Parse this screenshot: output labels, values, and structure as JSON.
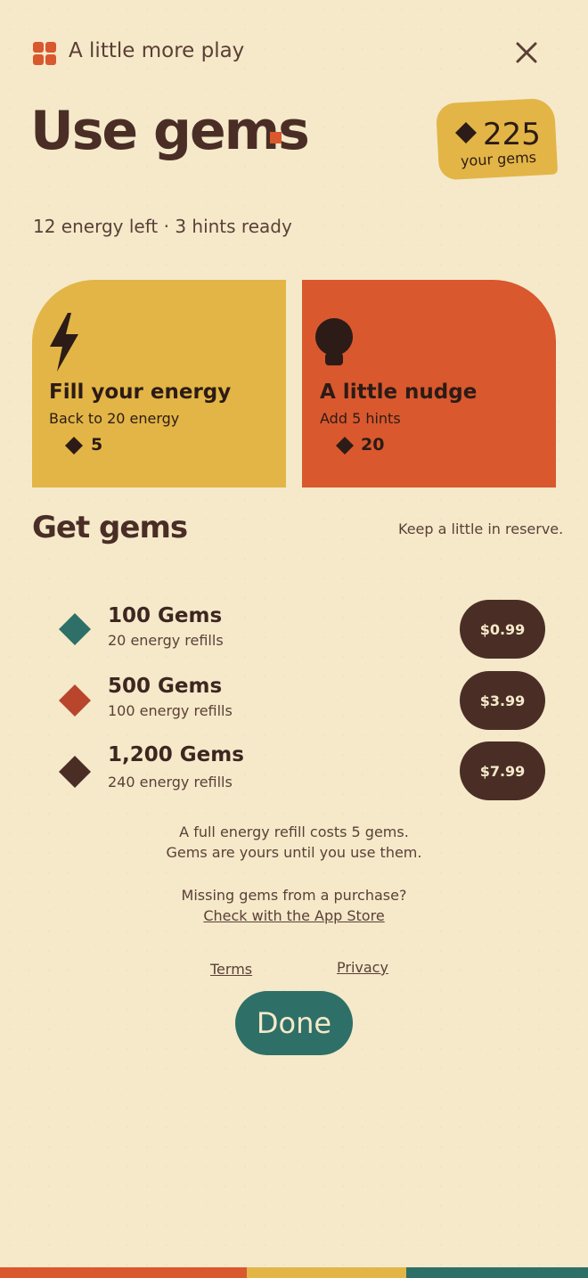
{
  "header": {
    "app_name": "A little more play",
    "close_icon": "close-icon"
  },
  "title": "Use gems",
  "balance": {
    "value": "225",
    "label": "your gems"
  },
  "status": "12 energy left · 3 hints ready",
  "cards": [
    {
      "icon": "lightning-icon",
      "title": "Fill your energy",
      "subtitle": "Back to 20 energy",
      "price": "5"
    },
    {
      "icon": "lightbulb-icon",
      "title": "A little nudge",
      "subtitle": "Add 5 hints",
      "price": "20"
    }
  ],
  "get_gems": {
    "title": "Get gems",
    "note": "Keep a little in reserve.",
    "packs": [
      {
        "name": "100 Gems",
        "desc": "20 energy refills",
        "price": "$0.99",
        "color": "#2e7067"
      },
      {
        "name": "500 Gems",
        "desc": "100 energy refills",
        "price": "$3.99",
        "color": "#b9452d"
      },
      {
        "name": "1,200 Gems",
        "desc": "240 energy refills",
        "price": "$7.99",
        "color": "#4a2e26"
      }
    ]
  },
  "info": {
    "line1": "A full energy refill costs 5 gems.",
    "line2": "Gems are yours until you use them.",
    "line3": "Missing gems from a purchase?",
    "link": "Check with the App Store"
  },
  "footer_links": {
    "terms": "Terms",
    "privacy": "Privacy"
  },
  "done_label": "Done",
  "colors": {
    "background": "#f5e9ca",
    "yellow": "#e2b546",
    "orange": "#d9582e",
    "teal": "#2e7067",
    "brown": "#4a2e26"
  }
}
